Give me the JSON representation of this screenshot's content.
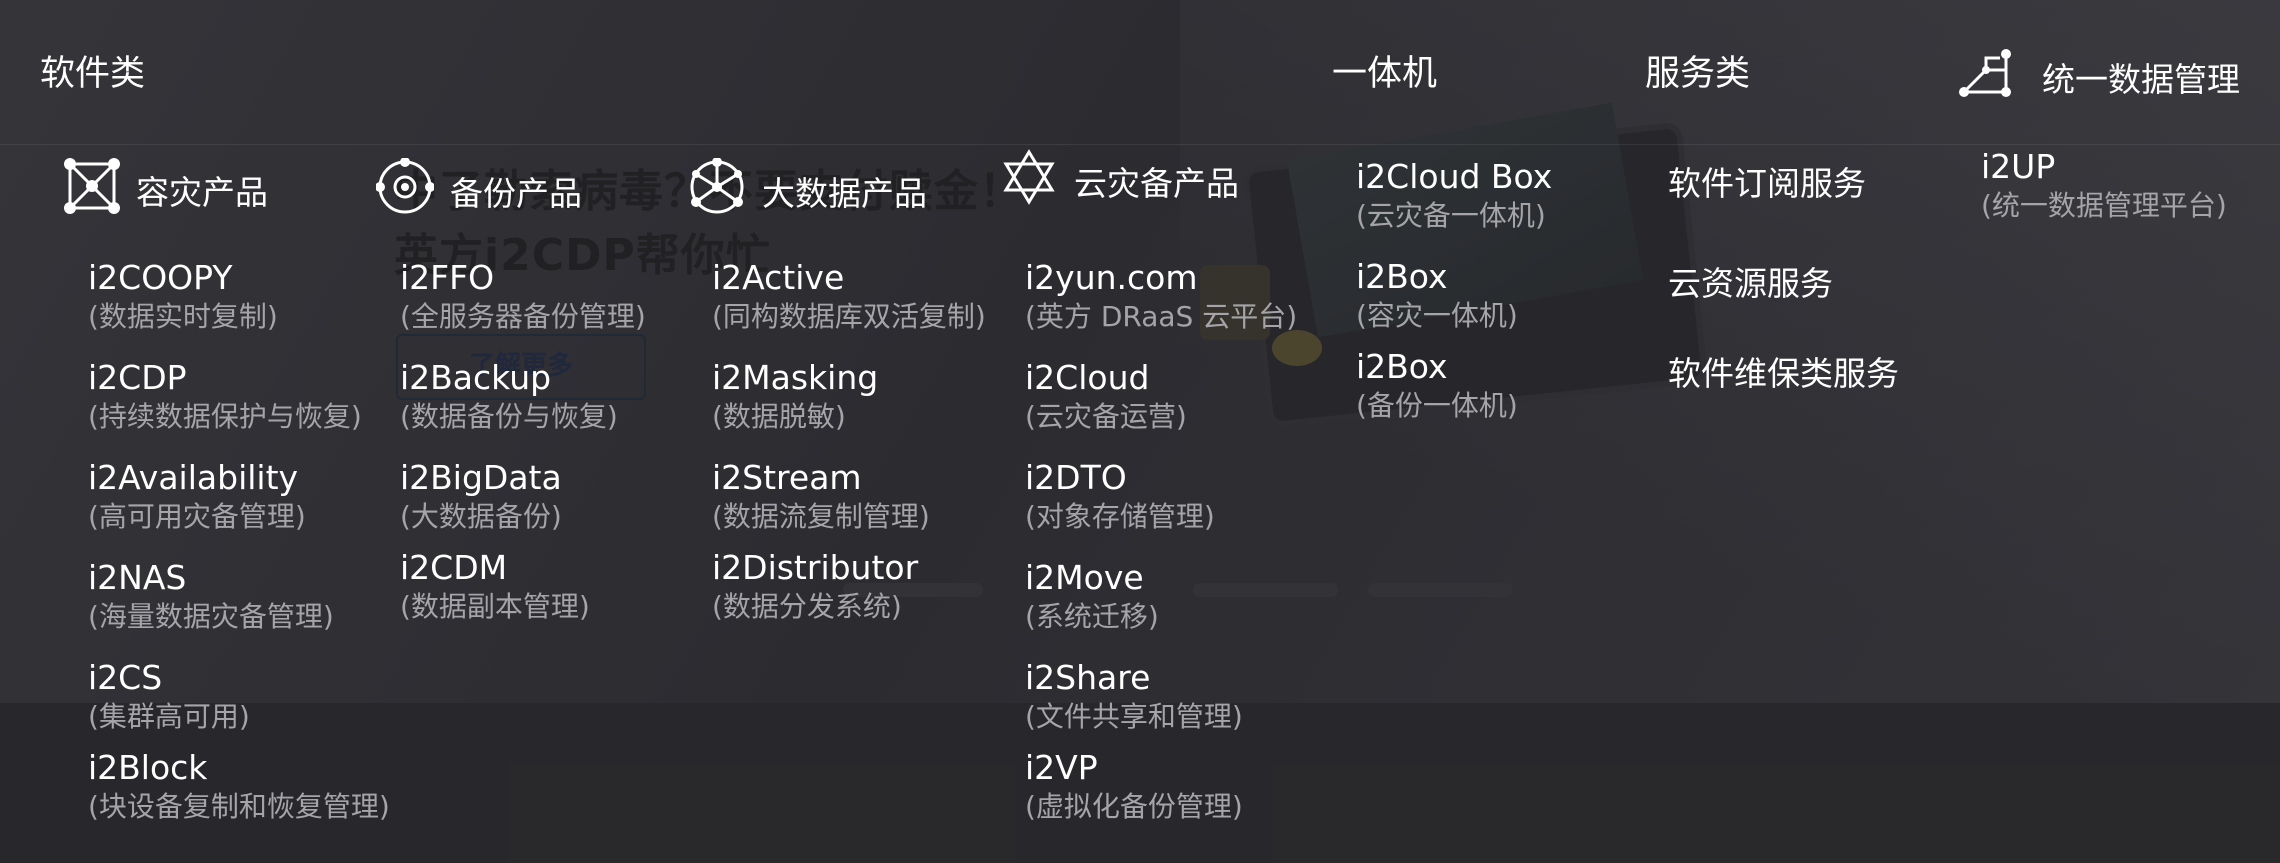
{
  "background": {
    "headline_lines": [
      "中了勒索病毒？不要支付赎金！",
      "英方i2CDP帮你忙"
    ],
    "cta_label": "了解更多"
  },
  "categories": {
    "software": "软件类",
    "appliance": "一体机",
    "services": "服务类",
    "unified": "统一数据管理"
  },
  "software": {
    "columns": [
      {
        "heading": "容灾产品",
        "icon": "network-square-icon",
        "items": [
          {
            "name": "i2COOPY",
            "desc": "(数据实时复制)"
          },
          {
            "name": "i2CDP",
            "desc": "(持续数据保护与恢复)"
          },
          {
            "name": "i2Availability",
            "desc": "(高可用灾备管理)"
          },
          {
            "name": "i2NAS",
            "desc": "(海量数据灾备管理)"
          },
          {
            "name": "i2CS",
            "desc": "(集群高可用)"
          },
          {
            "name": "i2Block",
            "desc": "(块设备复制和恢复管理)"
          }
        ]
      },
      {
        "heading": "备份产品",
        "icon": "target-circle-icon",
        "items": [
          {
            "name": "i2FFO",
            "desc": "(全服务器备份管理)"
          },
          {
            "name": "i2Backup",
            "desc": "(数据备份与恢复)"
          },
          {
            "name": "i2BigData",
            "desc": "(大数据备份)"
          },
          {
            "name": "i2CDM",
            "desc": "(数据副本管理)"
          }
        ]
      },
      {
        "heading": "大数据产品",
        "icon": "network-circle-icon",
        "items": [
          {
            "name": "i2Active",
            "desc": "(同构数据库双活复制)"
          },
          {
            "name": "i2Masking",
            "desc": "(数据脱敏)"
          },
          {
            "name": "i2Stream",
            "desc": "(数据流复制管理)"
          },
          {
            "name": "i2Distributor",
            "desc": "(数据分发系统)"
          }
        ]
      },
      {
        "heading": "云灾备产品",
        "icon": "hexagram-icon",
        "items": [
          {
            "name": "i2yun.com",
            "desc": "(英方 DRaaS 云平台)"
          },
          {
            "name": "i2Cloud",
            "desc": "(云灾备运营)"
          },
          {
            "name": "i2DTO",
            "desc": "(对象存储管理)"
          },
          {
            "name": "i2Move",
            "desc": "(系统迁移)"
          },
          {
            "name": "i2Share",
            "desc": "(文件共享和管理)"
          },
          {
            "name": "i2VP",
            "desc": "(虚拟化备份管理)"
          }
        ]
      }
    ]
  },
  "appliance": {
    "items": [
      {
        "name": "i2Cloud Box",
        "desc": "(云灾备一体机)"
      },
      {
        "name": "i2Box",
        "desc": "(容灾一体机)"
      },
      {
        "name": "i2Box",
        "desc": "(备份一体机)"
      }
    ]
  },
  "services": {
    "items": [
      "软件订阅服务",
      "云资源服务",
      "软件维保类服务"
    ]
  },
  "unified": {
    "icon": "topology-icon",
    "items": [
      {
        "name": "i2UP",
        "desc": "(统一数据管理平台)"
      }
    ]
  }
}
